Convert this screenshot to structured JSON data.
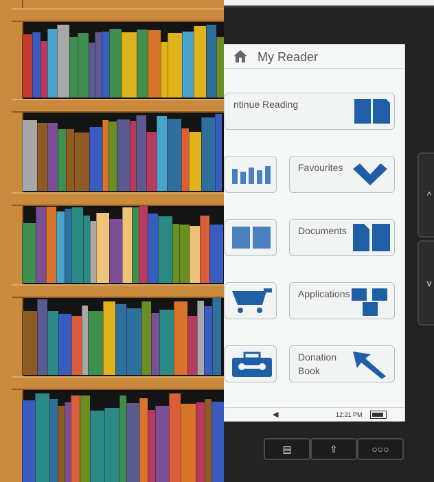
{
  "reader": {
    "title": "My Reader",
    "tiles": {
      "continue": "ntinue Reading",
      "favourites": "Favourites",
      "documents": "Documents",
      "applications": "Applications",
      "donation": "Donation\nBook"
    },
    "status": {
      "time": "12:21 PM"
    },
    "bottom_buttons": [
      "▤",
      "⇪",
      "○○○"
    ],
    "side_buttons": [
      "^",
      "v"
    ]
  },
  "icons": {
    "home": "home-icon",
    "continue": "open-book-icon",
    "favourites": "checkmark-icon",
    "documents": "documents-icon",
    "applications": "apps-icon",
    "donation": "arrow-cursor-icon",
    "library": "bar-chart-icon",
    "reading": "book-pages-icon",
    "store": "cart-icon",
    "settings": "toolbox-icon"
  },
  "colors": {
    "accent": "#1f5fa6",
    "wood": "#c98a3e",
    "device": "#232323"
  }
}
